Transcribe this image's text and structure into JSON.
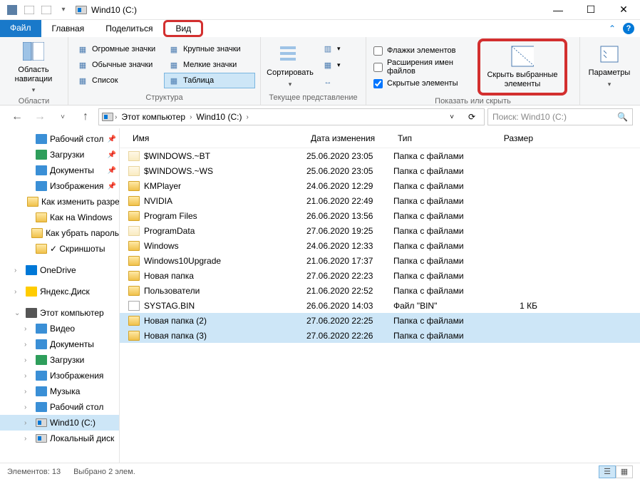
{
  "title": "Wind10 (C:)",
  "window_controls": {
    "min": "—",
    "max": "☐",
    "close": "✕"
  },
  "menu": {
    "file": "Файл",
    "home": "Главная",
    "share": "Поделиться",
    "view": "Вид",
    "collapse": "⌃"
  },
  "ribbon": {
    "g1_label": "Области",
    "nav_pane": "Область навигации",
    "layout_label": "Структура",
    "layout_items": [
      "Огромные значки",
      "Крупные значки",
      "Обычные значки",
      "Мелкие значки",
      "Список",
      "Таблица"
    ],
    "view_label": "Текущее представление",
    "sort": "Сортировать",
    "show_label": "Показать или скрыть",
    "chk1": "Флажки элементов",
    "chk2": "Расширения имен файлов",
    "chk3": "Скрытые элементы",
    "hide": "Скрыть выбранные элементы",
    "options": "Параметры"
  },
  "breadcrumb": {
    "seg1": "Этот компьютер",
    "seg2": "Wind10 (C:)"
  },
  "search_placeholder": "Поиск: Wind10 (C:)",
  "sidebar": [
    {
      "label": "Рабочий стол",
      "ico": "desktop",
      "pin": true,
      "lvl": 2
    },
    {
      "label": "Загрузки",
      "ico": "downloads",
      "pin": true,
      "lvl": 2
    },
    {
      "label": "Документы",
      "ico": "docs",
      "pin": true,
      "lvl": 2
    },
    {
      "label": "Изображения",
      "ico": "pics",
      "pin": true,
      "lvl": 2
    },
    {
      "label": "Как изменить разрешение",
      "ico": "folder",
      "lvl": 2
    },
    {
      "label": "Как на Windows",
      "ico": "folder",
      "lvl": 2
    },
    {
      "label": "Как убрать пароль",
      "ico": "folder",
      "lvl": 2
    },
    {
      "label": "Скриншоты",
      "ico": "folder",
      "check": true,
      "lvl": 2
    },
    {
      "blank": true
    },
    {
      "label": "OneDrive",
      "ico": "onedrive",
      "lvl": 1,
      "exp": ">"
    },
    {
      "blank": true
    },
    {
      "label": "Яндекс.Диск",
      "ico": "yadisk",
      "lvl": 1,
      "exp": ">"
    },
    {
      "blank": true
    },
    {
      "label": "Этот компьютер",
      "ico": "pc",
      "lvl": 1,
      "exp": "v"
    },
    {
      "label": "Видео",
      "ico": "video",
      "lvl": 2,
      "exp": ">"
    },
    {
      "label": "Документы",
      "ico": "docs",
      "lvl": 2,
      "exp": ">"
    },
    {
      "label": "Загрузки",
      "ico": "downloads",
      "lvl": 2,
      "exp": ">"
    },
    {
      "label": "Изображения",
      "ico": "pics",
      "lvl": 2,
      "exp": ">"
    },
    {
      "label": "Музыка",
      "ico": "music",
      "lvl": 2,
      "exp": ">"
    },
    {
      "label": "Рабочий стол",
      "ico": "desktop",
      "lvl": 2,
      "exp": ">"
    },
    {
      "label": "Wind10 (C:)",
      "ico": "drive",
      "lvl": 2,
      "exp": ">",
      "sel": true
    },
    {
      "label": "Локальный диск",
      "ico": "drive",
      "lvl": 2,
      "exp": ">"
    }
  ],
  "columns": {
    "name": "Имя",
    "date": "Дата изменения",
    "type": "Тип",
    "size": "Размер"
  },
  "files": [
    {
      "name": "$WINDOWS.~BT",
      "date": "25.06.2020 23:05",
      "type": "Папка с файлами",
      "ico": "folder-hidden"
    },
    {
      "name": "$WINDOWS.~WS",
      "date": "25.06.2020 23:05",
      "type": "Папка с файлами",
      "ico": "folder-hidden"
    },
    {
      "name": "KMPlayer",
      "date": "24.06.2020 12:29",
      "type": "Папка с файлами",
      "ico": "folder"
    },
    {
      "name": "NVIDIA",
      "date": "21.06.2020 22:49",
      "type": "Папка с файлами",
      "ico": "folder"
    },
    {
      "name": "Program Files",
      "date": "26.06.2020 13:56",
      "type": "Папка с файлами",
      "ico": "folder"
    },
    {
      "name": "ProgramData",
      "date": "27.06.2020 19:25",
      "type": "Папка с файлами",
      "ico": "folder-hidden"
    },
    {
      "name": "Windows",
      "date": "24.06.2020 12:33",
      "type": "Папка с файлами",
      "ico": "folder"
    },
    {
      "name": "Windows10Upgrade",
      "date": "21.06.2020 17:37",
      "type": "Папка с файлами",
      "ico": "folder"
    },
    {
      "name": "Новая папка",
      "date": "27.06.2020 22:23",
      "type": "Папка с файлами",
      "ico": "folder"
    },
    {
      "name": "Пользователи",
      "date": "21.06.2020 22:52",
      "type": "Папка с файлами",
      "ico": "folder"
    },
    {
      "name": "SYSTAG.BIN",
      "date": "26.06.2020 14:03",
      "type": "Файл \"BIN\"",
      "size": "1 КБ",
      "ico": "file"
    },
    {
      "name": "Новая папка (2)",
      "date": "27.06.2020 22:25",
      "type": "Папка с файлами",
      "ico": "folder",
      "sel": true
    },
    {
      "name": "Новая папка (3)",
      "date": "27.06.2020 22:26",
      "type": "Папка с файлами",
      "ico": "folder",
      "sel": true
    }
  ],
  "status": {
    "count": "Элементов: 13",
    "sel": "Выбрано 2 элем."
  }
}
